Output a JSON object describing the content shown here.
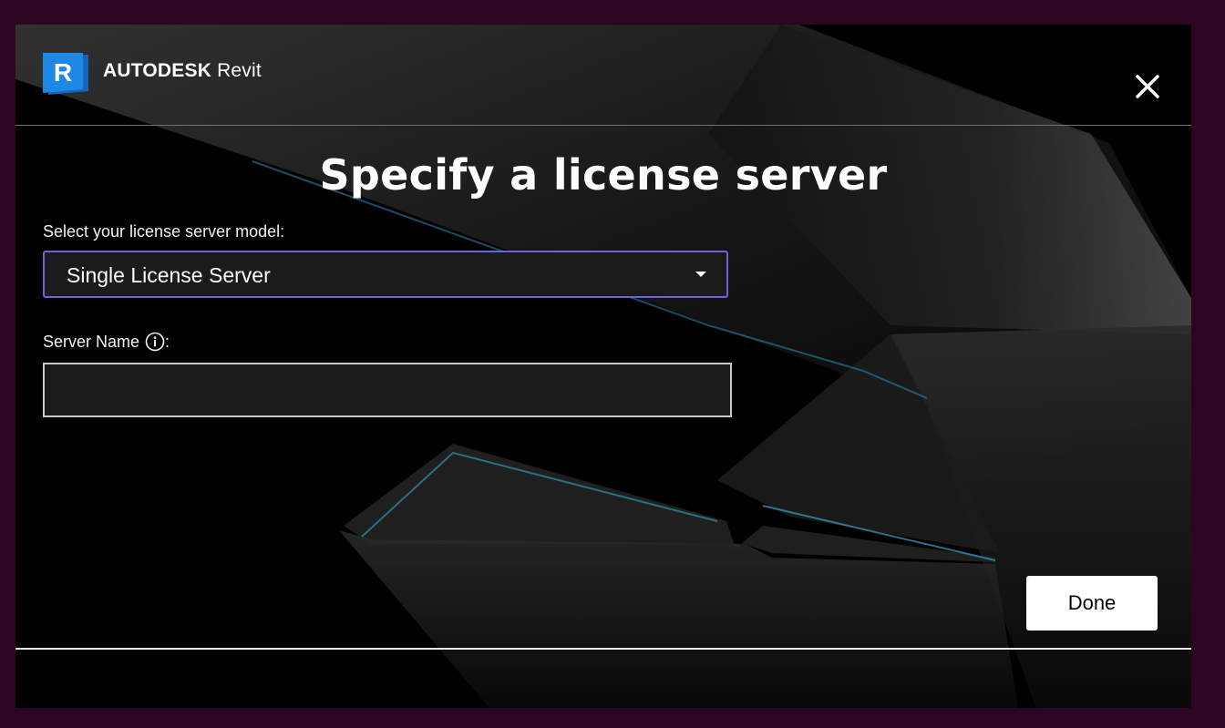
{
  "brand": {
    "company": "AUTODESK",
    "product": "Revit",
    "logo_letter": "R",
    "logo_color": "#1e88e5"
  },
  "header": {
    "close_icon": "close-icon"
  },
  "dialog": {
    "title": "Specify a license server",
    "model_label": "Select your license server model:",
    "model_selected": "Single License Server",
    "server_name_label": "Server Name",
    "server_name_suffix": ":",
    "server_name_value": "",
    "info_icon": "info-icon",
    "done_label": "Done"
  },
  "colors": {
    "outer_background": "#2c0522",
    "window_background": "#000000",
    "select_focus_border": "#6e62e0",
    "input_border": "#c9c9c9",
    "done_button_bg": "#ffffff"
  }
}
